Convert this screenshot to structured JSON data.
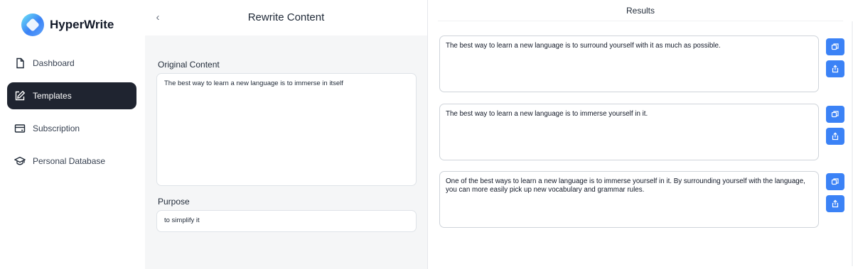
{
  "brand": {
    "name": "HyperWrite"
  },
  "sidebar": {
    "items": [
      {
        "label": "Dashboard",
        "icon": "document-icon",
        "active": false
      },
      {
        "label": "Templates",
        "icon": "edit-icon",
        "active": true
      },
      {
        "label": "Subscription",
        "icon": "card-icon",
        "active": false
      },
      {
        "label": "Personal Database",
        "icon": "graduation-cap-icon",
        "active": false
      }
    ]
  },
  "editor": {
    "title": "Rewrite Content",
    "original_label": "Original Content",
    "original_value": "The best way to learn a new language is to immerse in itself",
    "purpose_label": "Purpose",
    "purpose_value": "to simplify it"
  },
  "results": {
    "title": "Results",
    "items": [
      {
        "text": "The best way to learn a new language is to surround yourself with it as much as possible."
      },
      {
        "text": "The best way to learn a new language is to immerse yourself in it."
      },
      {
        "text": "One of the best ways to learn a new language is to immerse yourself in it. By surrounding yourself with the language, you can more easily pick up new vocabulary and grammar rules."
      }
    ]
  },
  "colors": {
    "accent": "#3b82f6",
    "active_nav": "#1f2430",
    "panel_bg": "#f5f6f7"
  }
}
